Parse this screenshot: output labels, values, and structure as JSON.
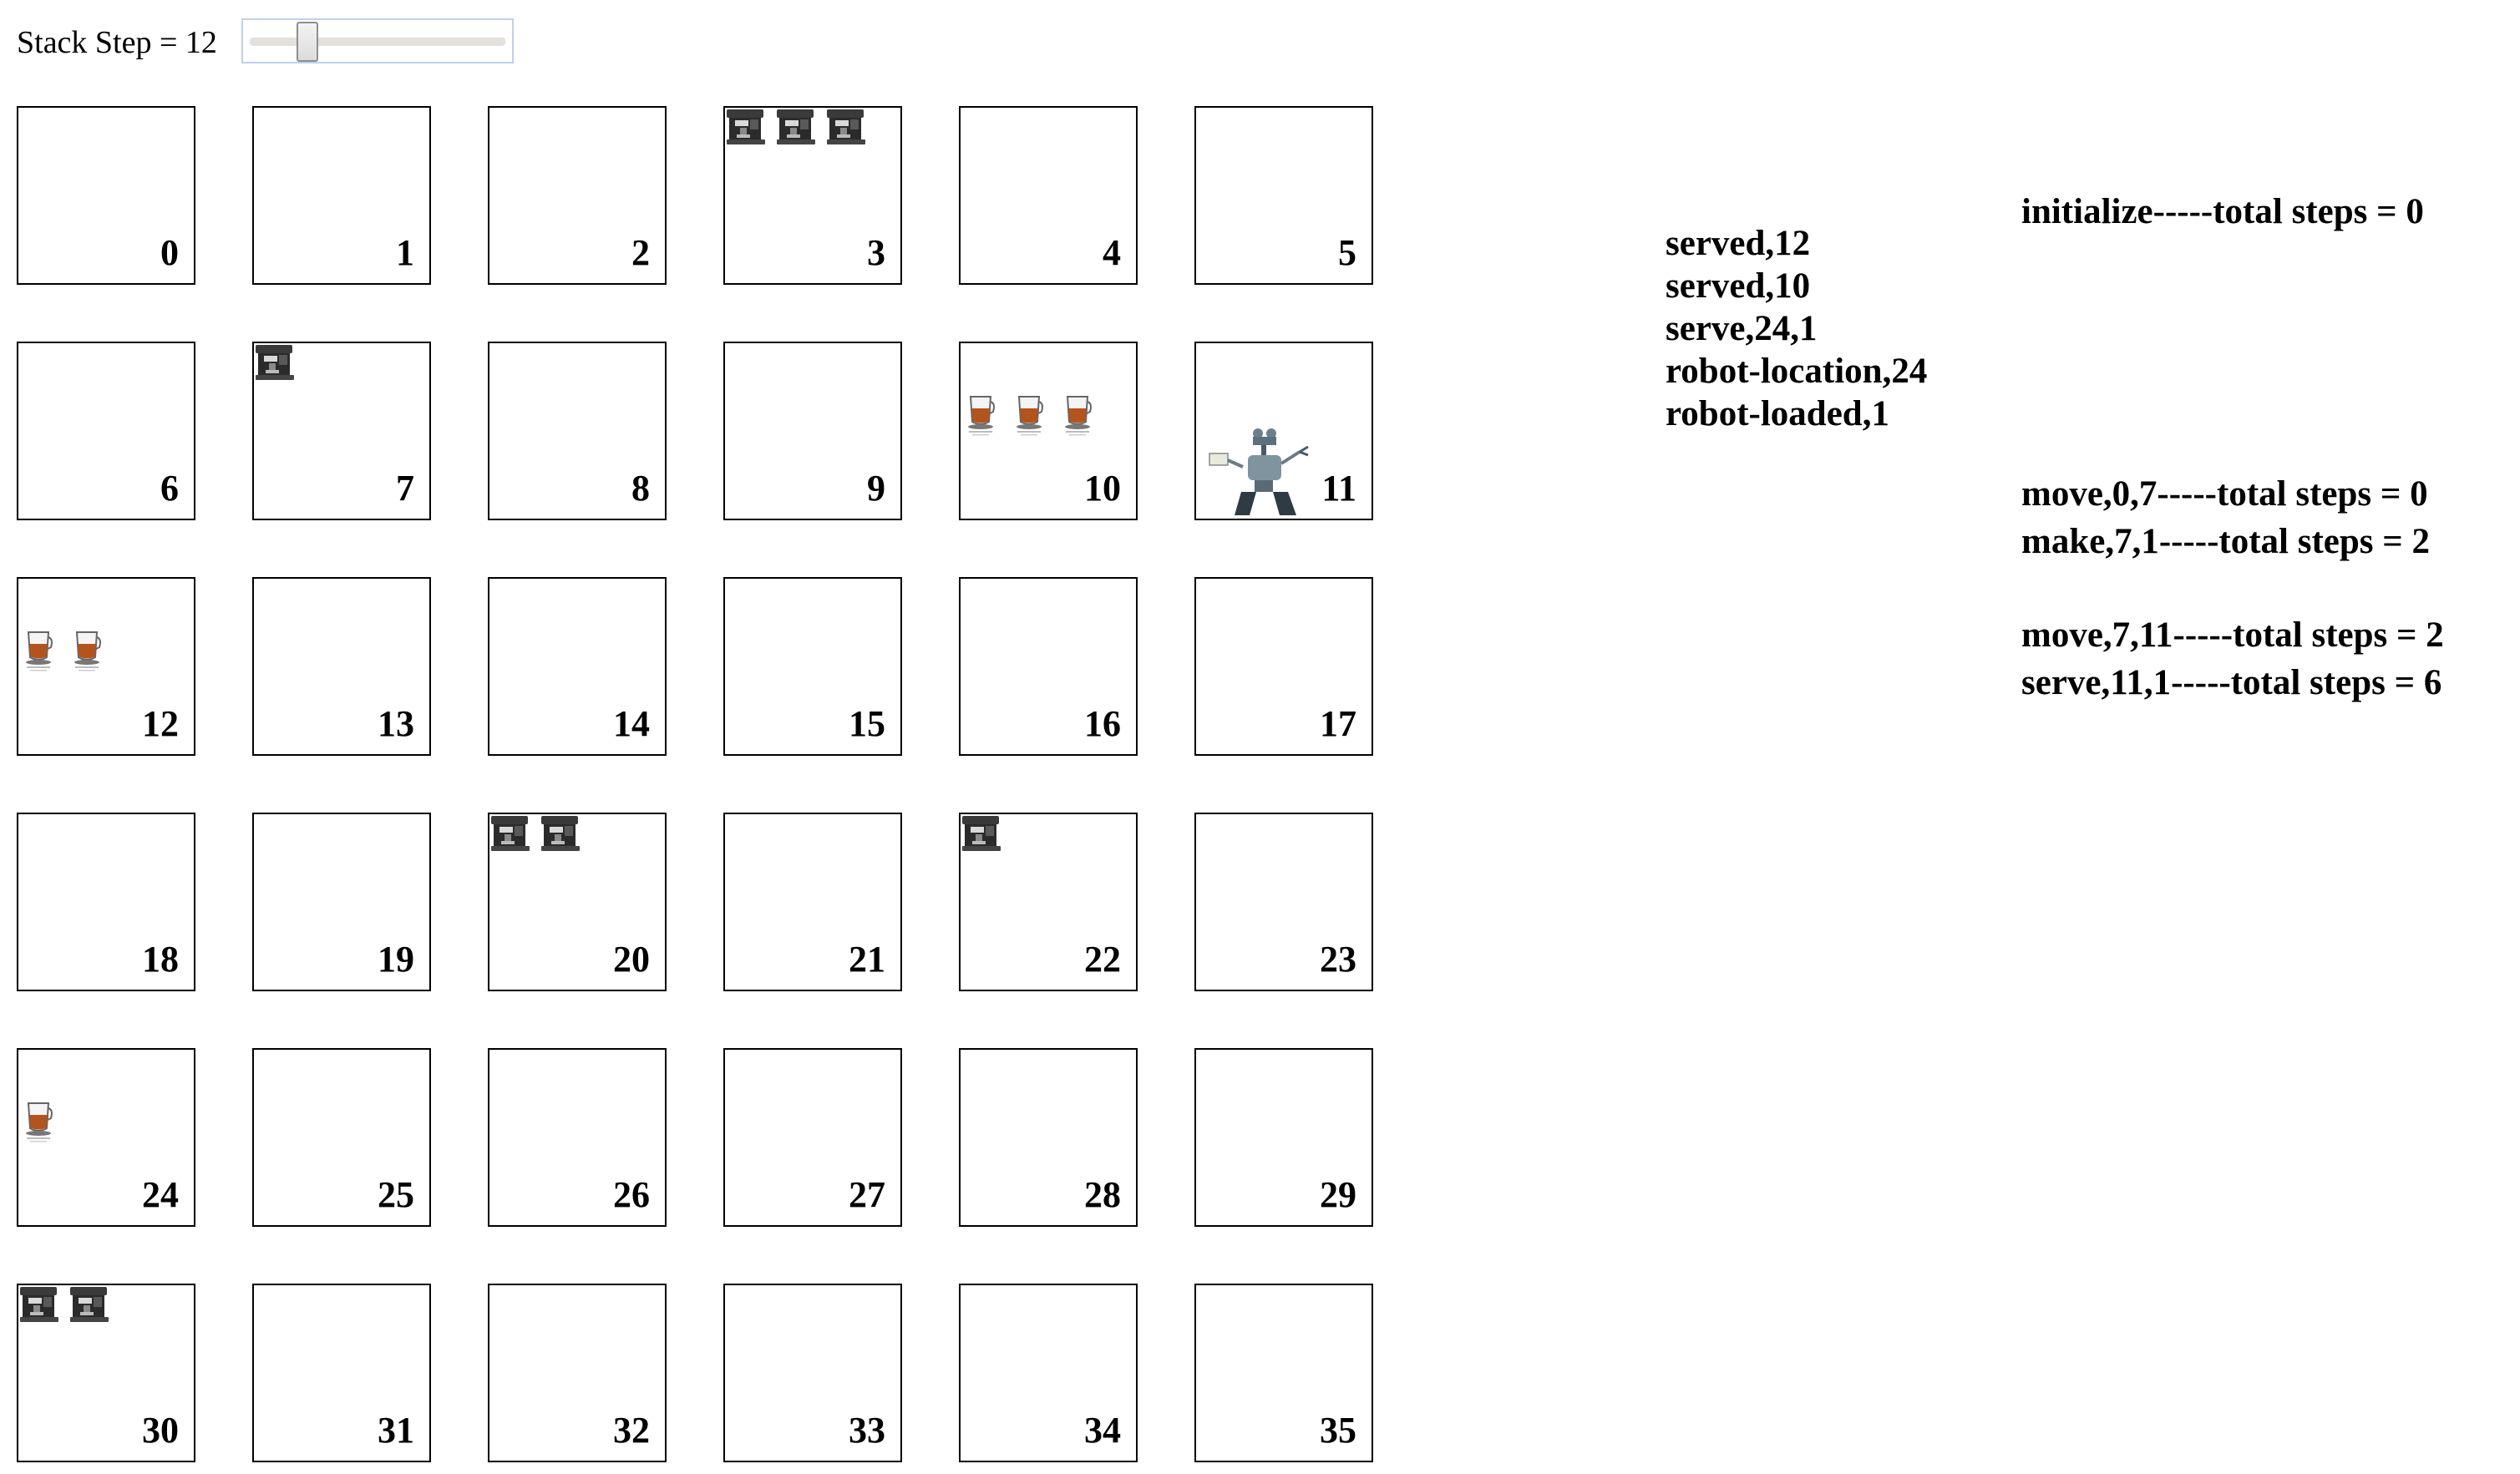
{
  "header": {
    "step_label": "Stack Step = 12",
    "slider_value": 12,
    "slider_min": 0,
    "slider_max": 60
  },
  "grid": {
    "cells": [
      {
        "label": "0",
        "items": []
      },
      {
        "label": "1",
        "items": []
      },
      {
        "label": "2",
        "items": []
      },
      {
        "label": "3",
        "items": [
          "coffee-machine-icon",
          "coffee-machine-icon",
          "coffee-machine-icon"
        ]
      },
      {
        "label": "4",
        "items": []
      },
      {
        "label": "5",
        "items": []
      },
      {
        "label": "6",
        "items": []
      },
      {
        "label": "7",
        "items": [
          "coffee-machine-icon"
        ]
      },
      {
        "label": "8",
        "items": []
      },
      {
        "label": "9",
        "items": []
      },
      {
        "label": "10",
        "items": [
          "coffee-cup-icon",
          "coffee-cup-icon",
          "coffee-cup-icon"
        ]
      },
      {
        "label": "11",
        "items": [
          "robot-icon"
        ]
      },
      {
        "label": "12",
        "items": [
          "coffee-cup-icon",
          "coffee-cup-icon"
        ]
      },
      {
        "label": "13",
        "items": []
      },
      {
        "label": "14",
        "items": []
      },
      {
        "label": "15",
        "items": []
      },
      {
        "label": "16",
        "items": []
      },
      {
        "label": "17",
        "items": []
      },
      {
        "label": "18",
        "items": []
      },
      {
        "label": "19",
        "items": []
      },
      {
        "label": "20",
        "items": [
          "coffee-machine-icon",
          "coffee-machine-icon"
        ]
      },
      {
        "label": "21",
        "items": []
      },
      {
        "label": "22",
        "items": [
          "coffee-machine-icon"
        ]
      },
      {
        "label": "23",
        "items": []
      },
      {
        "label": "24",
        "items": [
          "coffee-cup-icon"
        ]
      },
      {
        "label": "25",
        "items": []
      },
      {
        "label": "26",
        "items": []
      },
      {
        "label": "27",
        "items": []
      },
      {
        "label": "28",
        "items": []
      },
      {
        "label": "29",
        "items": []
      },
      {
        "label": "30",
        "items": [
          "coffee-machine-icon",
          "coffee-machine-icon"
        ]
      },
      {
        "label": "31",
        "items": []
      },
      {
        "label": "32",
        "items": []
      },
      {
        "label": "33",
        "items": []
      },
      {
        "label": "34",
        "items": []
      },
      {
        "label": "35",
        "items": []
      }
    ]
  },
  "state_stack": [
    "served,12",
    "served,10",
    "serve,24,1",
    "robot-location,24",
    "robot-loaded,1"
  ],
  "action_log": [
    "initialize-----total steps = 0",
    "move,0,7-----total steps = 0",
    "make,7,1-----total steps = 2",
    "move,7,11-----total steps = 2",
    "serve,11,1-----total steps = 6"
  ]
}
